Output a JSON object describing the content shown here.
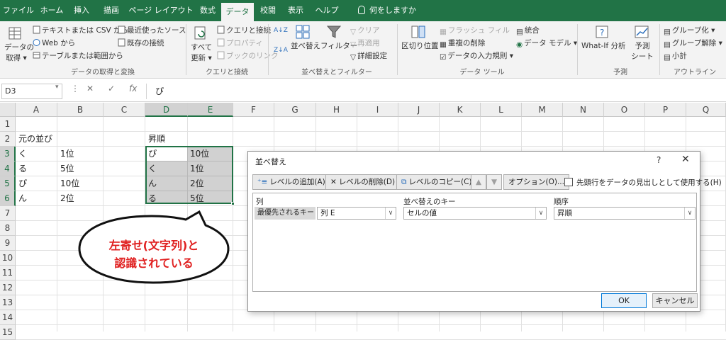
{
  "ribbon_tabs": [
    {
      "label": "ファイル"
    },
    {
      "label": "ホーム"
    },
    {
      "label": "挿入"
    },
    {
      "label": "描画"
    },
    {
      "label": "ページ レイアウト"
    },
    {
      "label": "数式"
    },
    {
      "label": "データ"
    },
    {
      "label": "校閲"
    },
    {
      "label": "表示"
    },
    {
      "label": "ヘルプ"
    },
    {
      "label": "何をしますか"
    }
  ],
  "ribbon": {
    "get_data": {
      "line1": "データの",
      "line2": "取得 ▾"
    },
    "from_text_csv": "テキストまたは CSV から",
    "from_web": "Web から",
    "from_table": "テーブルまたは範囲から",
    "recent_sources": "最近使ったソース",
    "existing_connections": "既存の接続",
    "group_get_transform": "データの取得と変換",
    "refresh_all": {
      "line1": "すべて",
      "line2": "更新 ▾"
    },
    "queries_connections": "クエリと接続",
    "properties": "プロパティ",
    "edit_links": "ブックのリンク",
    "group_queries": "クエリと接続",
    "sort_az": "A↓Z",
    "sort_za": "Z↓A",
    "sort": "並べ替え",
    "filter": "フィルター",
    "clear": "クリア",
    "reapply": "再適用",
    "advanced": "詳細設定",
    "group_sort_filter": "並べ替えとフィルター",
    "text_to_columns": "区切り位置",
    "flash_fill": "フラッシュ フィル",
    "remove_duplicates": "重複の削除",
    "data_validation": "データの入力規則 ▾",
    "consolidate": "統合",
    "data_model": "データ モデル ▾",
    "group_data_tools": "データ ツール",
    "what_if": "What-If 分析",
    "forecast_sheet": {
      "line1": "予測",
      "line2": "シート"
    },
    "group_forecast": "予測",
    "group_button": "グループ化 ▾",
    "ungroup_button": "グループ解除 ▾",
    "subtotal": "小計",
    "group_outline": "アウトライン"
  },
  "formula_bar": {
    "name_box": "D3",
    "cancel_symbol": "✕",
    "enter_symbol": "✓",
    "fx": "fx",
    "value": "ぴ"
  },
  "columns": [
    "A",
    "B",
    "C",
    "D",
    "E",
    "F",
    "G",
    "H",
    "I",
    "J",
    "K",
    "L",
    "M",
    "N",
    "O",
    "P",
    "Q"
  ],
  "rows": [
    "1",
    "2",
    "3",
    "4",
    "5",
    "6",
    "7",
    "8",
    "9",
    "10",
    "11",
    "12",
    "13",
    "14",
    "15"
  ],
  "cells": {
    "A2": "元の並び",
    "D2": "昇順",
    "A3": "く",
    "B3": "1位",
    "D3": "ぴ",
    "E3": "10位",
    "A4": "る",
    "B4": "5位",
    "D4": "く",
    "E4": "1位",
    "A5": "ぴ",
    "B5": "10位",
    "D5": "ん",
    "E5": "2位",
    "A6": "ん",
    "B6": "2位",
    "D6": "る",
    "E6": "5位"
  },
  "callout": {
    "line1": "左寄せ(文字列)と",
    "line2": "認識されている",
    "text_color": "#e02020"
  },
  "sort_dialog": {
    "title": "並べ替え",
    "help": "?",
    "close": "✕",
    "add_level": "レベルの追加(A)",
    "delete_level": "レベルの削除(D)",
    "copy_level": "レベルのコピー(C)",
    "move_up": "▲",
    "move_down": "▼",
    "options": "オプション(O)...",
    "header_checkbox": "先頭行をデータの見出しとして使用する(H)",
    "col_header_column": "列",
    "col_header_key": "並べ替えのキー",
    "col_header_order": "順序",
    "row_label": "最優先されるキー",
    "column_value": "列 E",
    "key_value": "セルの値",
    "order_value": "昇順",
    "ok": "OK",
    "cancel": "キャンセル"
  },
  "colors": {
    "excel_green": "#217346",
    "ribbon_bg": "#f3f3f3"
  }
}
